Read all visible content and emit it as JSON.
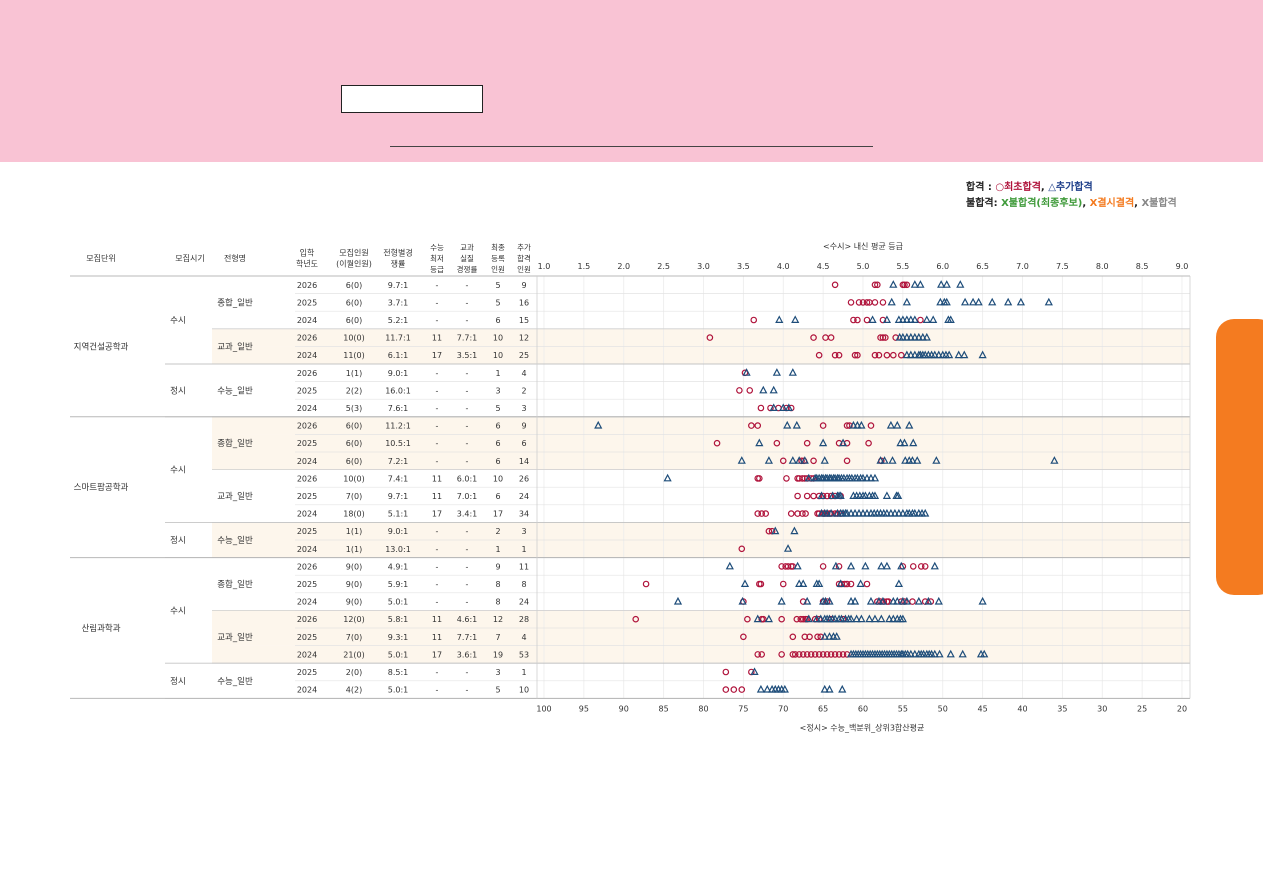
{
  "legend": {
    "pass_label": "합격",
    "pass_sep": " : ",
    "pass_first": "○최초합격",
    "pass_comma": ", ",
    "pass_added": "△추가합격",
    "fail_label": "불합격: ",
    "fail_wait": "X불합격(최종후보)",
    "fail_absent": "X결시결격",
    "fail_other": "X불합격"
  },
  "colors": {
    "banner": "#f9c3d4",
    "first_pass": "#b0143c",
    "added_pass": "#1e4d7a",
    "highlight_row": "#fdf6ec",
    "side_tab": "#f47b20"
  },
  "headers": [
    "모집단위",
    "모집시기",
    "전형명",
    "입학\n학년도",
    "모집인원\n(이월인원)",
    "전형별경\n쟁률",
    "수능\n최저\n등급",
    "교과\n실질\n경쟁률",
    "최종\n등록\n인원",
    "추가\n합격\n인원"
  ],
  "chart_data": {
    "type": "scatter",
    "title": "<수시> 내신 평균 등급",
    "x_top_label": "<수시> 내신 평균 등급",
    "x_top_ticks": [
      "1.0",
      "1.5",
      "2.0",
      "2.5",
      "3.0",
      "3.5",
      "4.0",
      "4.5",
      "5.0",
      "5.5",
      "6.0",
      "6.5",
      "7.0",
      "7.5",
      "8.0",
      "8.5",
      "9.0"
    ],
    "x_top_range": [
      1.0,
      9.0
    ],
    "x_bottom_label": "<정시> 수능_백분위_상위3합산평균",
    "x_bottom_ticks": [
      "100",
      "95",
      "90",
      "85",
      "80",
      "75",
      "70",
      "65",
      "60",
      "55",
      "50",
      "45",
      "40",
      "35",
      "30",
      "25",
      "20"
    ],
    "x_bottom_range": [
      100,
      20
    ],
    "series": [
      {
        "name": "○최초합격",
        "marker": "circle"
      },
      {
        "name": "△추가합격",
        "marker": "triangle"
      }
    ],
    "rows": [
      {
        "unit": "지역건설공학과",
        "period": "수시",
        "type": "종합_일반",
        "year": "2026",
        "quota": "6(0)",
        "rate": "9.7:1",
        "min": "-",
        "real": "-",
        "reg": "5",
        "add": "9",
        "bg": "w",
        "first": [
          4.65,
          5.15,
          5.18,
          5.5,
          5.52,
          5.55
        ],
        "extra": [
          5.38,
          5.65,
          5.72,
          5.98,
          6.05,
          6.22
        ]
      },
      {
        "unit": "지역건설공학과",
        "period": "수시",
        "type": "종합_일반",
        "year": "2025",
        "quota": "6(0)",
        "rate": "3.7:1",
        "min": "-",
        "real": "-",
        "reg": "5",
        "add": "16",
        "bg": "w",
        "first": [
          4.85,
          4.95,
          5.0,
          5.05,
          5.08,
          5.15,
          5.25
        ],
        "extra": [
          5.36,
          5.55,
          5.97,
          6.02,
          6.05,
          6.28,
          6.38,
          6.45,
          6.62,
          6.82,
          6.98,
          7.33
        ]
      },
      {
        "unit": "지역건설공학과",
        "period": "수시",
        "type": "종합_일반",
        "year": "2024",
        "quota": "6(0)",
        "rate": "5.2:1",
        "min": "-",
        "real": "-",
        "reg": "6",
        "add": "15",
        "bg": "w",
        "first": [
          3.63,
          4.88,
          4.93,
          5.05,
          5.25,
          5.72
        ],
        "extra": [
          3.95,
          4.15,
          5.12,
          5.3,
          5.45,
          5.5,
          5.55,
          5.6,
          5.65,
          5.8,
          5.88,
          6.07,
          6.1
        ]
      },
      {
        "unit": "지역건설공학과",
        "period": "수시",
        "type": "교과_일반",
        "year": "2026",
        "quota": "10(0)",
        "rate": "11.7:1",
        "min": "11",
        "real": "7.7:1",
        "reg": "10",
        "add": "12",
        "bg": "y",
        "first": [
          3.08,
          4.38,
          4.53,
          4.6,
          5.22,
          5.25,
          5.28,
          5.41
        ],
        "extra": [
          5.46,
          5.5,
          5.55,
          5.6,
          5.65,
          5.7,
          5.75,
          5.8
        ]
      },
      {
        "unit": "지역건설공학과",
        "period": "수시",
        "type": "교과_일반",
        "year": "2024",
        "quota": "11(0)",
        "rate": "6.1:1",
        "min": "17",
        "real": "3.5:1",
        "reg": "10",
        "add": "25",
        "bg": "y",
        "first": [
          4.45,
          4.65,
          4.7,
          4.9,
          4.93,
          5.15,
          5.2,
          5.3,
          5.38,
          5.48
        ],
        "extra": [
          5.55,
          5.6,
          5.65,
          5.7,
          5.72,
          5.75,
          5.78,
          5.82,
          5.86,
          5.9,
          5.95,
          6.0,
          6.04,
          6.08,
          6.2,
          6.27,
          6.5
        ]
      },
      {
        "unit": "지역건설공학과",
        "period": "정시",
        "type": "수능_일반",
        "year": "2026",
        "quota": "1(1)",
        "rate": "9.0:1",
        "min": "-",
        "real": "-",
        "reg": "1",
        "add": "4",
        "bg": "w",
        "first": [
          74.8
        ],
        "extra": [
          74.6,
          70.8,
          68.8
        ]
      },
      {
        "unit": "지역건설공학과",
        "period": "정시",
        "type": "수능_일반",
        "year": "2025",
        "quota": "2(2)",
        "rate": "16.0:1",
        "min": "-",
        "real": "-",
        "reg": "3",
        "add": "2",
        "bg": "w",
        "first": [
          75.5,
          74.2
        ],
        "extra": [
          72.5,
          71.2
        ]
      },
      {
        "unit": "지역건설공학과",
        "period": "정시",
        "type": "수능_일반",
        "year": "2024",
        "quota": "5(3)",
        "rate": "7.6:1",
        "min": "-",
        "real": "-",
        "reg": "5",
        "add": "3",
        "bg": "w",
        "first": [
          72.8,
          71.6,
          70.6,
          69.6,
          69.0
        ],
        "extra": [
          71.2,
          70.0,
          69.3
        ]
      },
      {
        "unit": "스마트팜공학과",
        "period": "수시",
        "type": "종합_일반",
        "year": "2026",
        "quota": "6(0)",
        "rate": "11.2:1",
        "min": "-",
        "real": "-",
        "reg": "6",
        "add": "9",
        "bg": "y",
        "first": [
          3.6,
          3.68,
          4.5,
          4.8,
          4.83,
          5.1
        ],
        "extra": [
          1.68,
          4.05,
          4.17,
          4.88,
          4.93,
          4.98,
          5.35,
          5.43,
          5.58
        ]
      },
      {
        "unit": "스마트팜공학과",
        "period": "수시",
        "type": "종합_일반",
        "year": "2025",
        "quota": "6(0)",
        "rate": "10.5:1",
        "min": "-",
        "real": "-",
        "reg": "6",
        "add": "6",
        "bg": "y",
        "first": [
          3.17,
          3.92,
          4.3,
          4.7,
          4.8,
          5.07
        ],
        "extra": [
          3.7,
          4.5,
          4.75,
          5.47,
          5.52,
          5.63
        ]
      },
      {
        "unit": "스마트팜공학과",
        "period": "수시",
        "type": "종합_일반",
        "year": "2024",
        "quota": "6(0)",
        "rate": "7.2:1",
        "min": "-",
        "real": "-",
        "reg": "6",
        "add": "14",
        "bg": "y",
        "first": [
          4.0,
          4.23,
          4.26,
          4.38,
          4.8,
          5.23
        ],
        "extra": [
          3.48,
          3.82,
          4.12,
          4.2,
          4.27,
          4.52,
          5.22,
          5.27,
          5.37,
          5.53,
          5.58,
          5.62,
          5.68,
          5.92,
          7.4
        ]
      },
      {
        "unit": "스마트팜공학과",
        "period": "수시",
        "type": "교과_일반",
        "year": "2026",
        "quota": "10(0)",
        "rate": "7.4:1",
        "min": "11",
        "real": "6.0:1",
        "reg": "10",
        "add": "26",
        "bg": "w",
        "first": [
          3.68,
          3.7,
          4.04,
          4.18,
          4.2,
          4.24,
          4.27,
          4.3,
          4.35,
          4.38
        ],
        "extra": [
          2.55,
          4.32,
          4.4,
          4.42,
          4.45,
          4.48,
          4.5,
          4.53,
          4.55,
          4.58,
          4.6,
          4.63,
          4.65,
          4.68,
          4.7,
          4.73,
          4.76,
          4.8,
          4.83,
          4.86,
          4.9,
          4.93,
          4.97,
          5.0,
          5.05,
          5.1,
          5.15
        ]
      },
      {
        "unit": "스마트팜공학과",
        "period": "수시",
        "type": "교과_일반",
        "year": "2025",
        "quota": "7(0)",
        "rate": "9.7:1",
        "min": "11",
        "real": "7.0:1",
        "reg": "6",
        "add": "24",
        "bg": "w",
        "first": [
          4.18,
          4.3,
          4.38,
          4.45,
          4.5,
          4.55,
          4.6,
          4.65,
          4.72
        ],
        "extra": [
          4.48,
          4.62,
          4.68,
          4.7,
          4.72,
          4.88,
          4.92,
          4.96,
          5.0,
          5.03,
          5.08,
          5.12,
          5.15,
          5.3,
          5.42,
          5.44
        ]
      },
      {
        "unit": "스마트팜공학과",
        "period": "수시",
        "type": "교과_일반",
        "year": "2024",
        "quota": "18(0)",
        "rate": "5.1:1",
        "min": "17",
        "real": "3.4:1",
        "reg": "17",
        "add": "34",
        "bg": "w",
        "first": [
          3.68,
          3.73,
          3.78,
          4.1,
          4.18,
          4.24,
          4.28,
          4.43,
          4.45,
          4.5,
          4.52,
          4.55,
          4.58,
          4.6,
          4.65,
          4.68,
          4.72
        ],
        "extra": [
          4.48,
          4.52,
          4.55,
          4.6,
          4.68,
          4.72,
          4.75,
          4.78,
          4.8,
          4.85,
          4.9,
          4.95,
          5.0,
          5.05,
          5.1,
          5.14,
          5.18,
          5.22,
          5.26,
          5.3,
          5.35,
          5.4,
          5.45,
          5.5,
          5.55,
          5.58,
          5.62,
          5.65,
          5.7,
          5.74,
          5.78
        ]
      },
      {
        "unit": "스마트팜공학과",
        "period": "정시",
        "type": "수능_일반",
        "year": "2025",
        "quota": "1(1)",
        "rate": "9.0:1",
        "min": "-",
        "real": "-",
        "reg": "2",
        "add": "3",
        "bg": "y",
        "first": [
          71.8,
          71.4
        ],
        "extra": [
          71.0,
          68.6
        ]
      },
      {
        "unit": "스마트팜공학과",
        "period": "정시",
        "type": "수능_일반",
        "year": "2024",
        "quota": "1(1)",
        "rate": "13.0:1",
        "min": "-",
        "real": "-",
        "reg": "1",
        "add": "1",
        "bg": "y",
        "first": [
          75.2
        ],
        "extra": [
          69.4
        ]
      },
      {
        "unit": "산림과학과",
        "period": "수시",
        "type": "종합_일반",
        "year": "2026",
        "quota": "9(0)",
        "rate": "4.9:1",
        "min": "-",
        "real": "-",
        "reg": "9",
        "add": "11",
        "bg": "w",
        "first": [
          3.98,
          4.03,
          4.06,
          4.1,
          4.12,
          4.5,
          4.7,
          5.5,
          5.63,
          5.73,
          5.78
        ],
        "extra": [
          3.33,
          4.18,
          4.66,
          4.85,
          5.03,
          5.23,
          5.3,
          5.48,
          5.9
        ]
      },
      {
        "unit": "산림과학과",
        "period": "수시",
        "type": "종합_일반",
        "year": "2025",
        "quota": "9(0)",
        "rate": "5.9:1",
        "min": "-",
        "real": "-",
        "reg": "8",
        "add": "8",
        "bg": "w",
        "first": [
          2.28,
          3.7,
          3.72,
          4.0,
          4.7,
          4.73,
          4.77,
          4.8,
          4.85,
          5.05
        ],
        "extra": [
          3.52,
          4.2,
          4.25,
          4.42,
          4.45,
          4.72,
          4.97,
          5.45
        ]
      },
      {
        "unit": "산림과학과",
        "period": "수시",
        "type": "종합_일반",
        "year": "2024",
        "quota": "9(0)",
        "rate": "5.0:1",
        "min": "-",
        "real": "-",
        "reg": "8",
        "add": "24",
        "bg": "w",
        "first": [
          3.5,
          4.25,
          4.5,
          4.55,
          5.18,
          5.22,
          5.26,
          5.3,
          5.32,
          5.48,
          5.52,
          5.62,
          5.78,
          5.85
        ],
        "extra": [
          2.68,
          3.49,
          3.98,
          4.3,
          4.5,
          4.53,
          4.58,
          4.85,
          4.9,
          5.1,
          5.2,
          5.25,
          5.38,
          5.43,
          5.5,
          5.55,
          5.7,
          5.82,
          5.95,
          6.5
        ]
      },
      {
        "unit": "산림과학과",
        "period": "수시",
        "type": "교과_일반",
        "year": "2026",
        "quota": "12(0)",
        "rate": "5.8:1",
        "min": "11",
        "real": "4.6:1",
        "reg": "12",
        "add": "28",
        "bg": "y",
        "first": [
          2.15,
          3.55,
          3.73,
          3.75,
          3.98,
          4.17,
          4.22,
          4.25,
          4.28,
          4.3,
          4.4,
          4.45,
          4.6,
          4.75
        ],
        "extra": [
          3.68,
          3.82,
          4.32,
          4.42,
          4.47,
          4.52,
          4.55,
          4.58,
          4.62,
          4.65,
          4.7,
          4.73,
          4.78,
          4.82,
          4.85,
          4.92,
          4.98,
          5.08,
          5.15,
          5.23,
          5.33,
          5.38,
          5.43,
          5.47,
          5.5
        ]
      },
      {
        "unit": "산림과학과",
        "period": "수시",
        "type": "교과_일반",
        "year": "2025",
        "quota": "7(0)",
        "rate": "9.3:1",
        "min": "11",
        "real": "7.7:1",
        "reg": "7",
        "add": "4",
        "bg": "y",
        "first": [
          3.5,
          4.12,
          4.27,
          4.33,
          4.43,
          4.47
        ],
        "extra": [
          4.52,
          4.58,
          4.63,
          4.67
        ]
      },
      {
        "unit": "산림과학과",
        "period": "수시",
        "type": "교과_일반",
        "year": "2024",
        "quota": "21(0)",
        "rate": "5.0:1",
        "min": "17",
        "real": "3.6:1",
        "reg": "19",
        "add": "53",
        "bg": "y",
        "first": [
          3.68,
          3.73,
          3.98,
          4.12,
          4.15,
          4.2,
          4.25,
          4.3,
          4.35,
          4.4,
          4.45,
          4.5,
          4.55,
          4.6,
          4.65,
          4.7,
          4.75,
          4.8
        ],
        "extra": [
          4.85,
          4.88,
          4.91,
          4.94,
          4.97,
          5.0,
          5.03,
          5.06,
          5.09,
          5.12,
          5.15,
          5.18,
          5.21,
          5.24,
          5.27,
          5.3,
          5.33,
          5.36,
          5.39,
          5.42,
          5.45,
          5.48,
          5.5,
          5.53,
          5.56,
          5.6,
          5.65,
          5.7,
          5.73,
          5.76,
          5.8,
          5.83,
          5.86,
          5.9,
          5.96,
          6.1,
          6.25,
          6.48,
          6.52
        ]
      },
      {
        "unit": "산림과학과",
        "period": "정시",
        "type": "수능_일반",
        "year": "2025",
        "quota": "2(0)",
        "rate": "8.5:1",
        "min": "-",
        "real": "-",
        "reg": "3",
        "add": "1",
        "bg": "w",
        "first": [
          77.2,
          74.0
        ],
        "extra": [
          73.6
        ]
      },
      {
        "unit": "산림과학과",
        "period": "정시",
        "type": "수능_일반",
        "year": "2024",
        "quota": "4(2)",
        "rate": "5.0:1",
        "min": "-",
        "real": "-",
        "reg": "5",
        "add": "10",
        "bg": "w",
        "first": [
          77.2,
          76.2,
          75.2
        ],
        "extra": [
          72.8,
          72.0,
          71.4,
          71.0,
          70.6,
          70.2,
          69.8,
          64.8,
          64.2,
          62.6
        ]
      }
    ]
  }
}
